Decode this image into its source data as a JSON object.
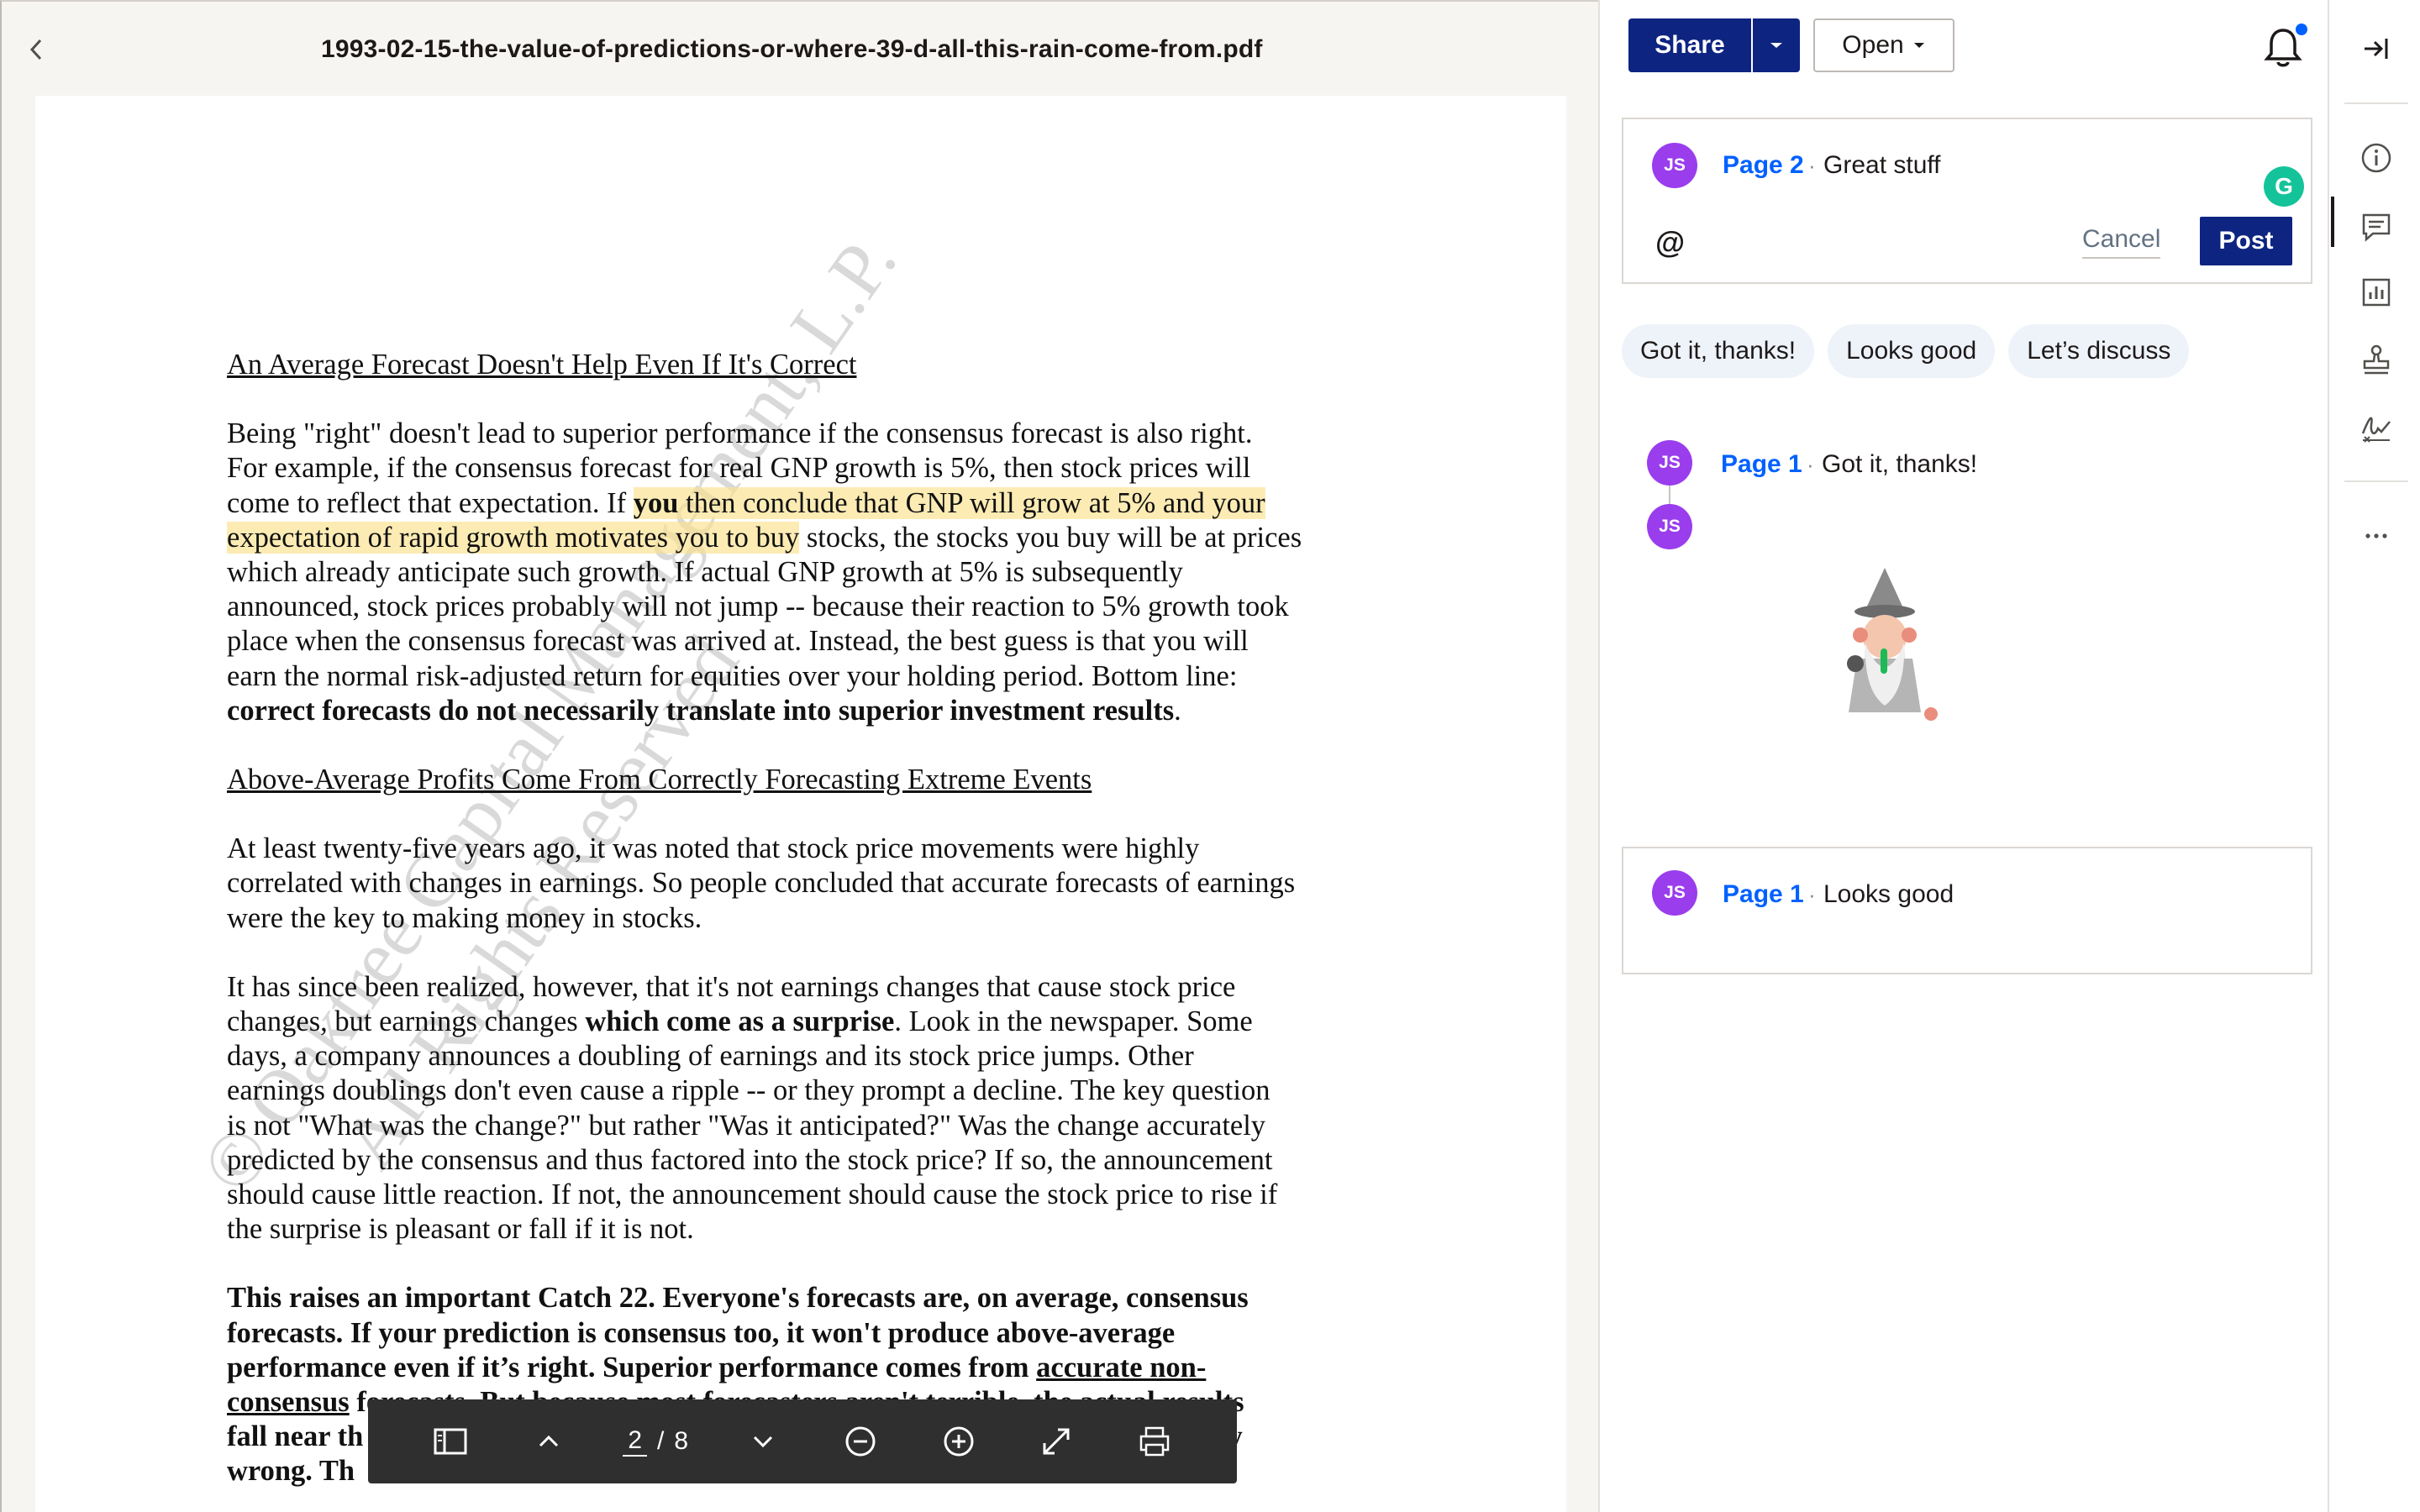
{
  "viewer": {
    "file_name": "1993-02-15-the-value-of-predictions-or-where-39-d-all-this-rain-come-from.pdf",
    "back_icon": "chevron-left-icon"
  },
  "document": {
    "heading1": "An Average Forecast Doesn't Help Even If It's Correct",
    "p1_lines": [
      "Being \"right\" doesn't lead to superior performance if the consensus forecast is also right.",
      "For example, if the consensus forecast for real GNP growth is 5%, then stock prices will",
      "come to reflect that expectation.  If "
    ],
    "p1_hl_bold": "you",
    "p1_hl_a": " then conclude that GNP will grow at 5% and your",
    "p1_hl_b": "expectation of rapid growth motivates you to buy",
    "p1_rest": " stocks, the stocks you buy will be at prices",
    "p1_lines2": [
      "which already anticipate such growth.  If actual GNP growth at 5% is subsequently",
      "announced, stock prices probably will not jump -- because their reaction to 5% growth took",
      "place when the consensus forecast was arrived at.  Instead, the best guess is that you will",
      "earn the normal risk-adjusted return for equities over your holding period.  Bottom line:"
    ],
    "p1_bold_end": "correct forecasts do not necessarily translate into superior investment results",
    "heading2": "Above-Average Profits Come From Correctly Forecasting Extreme Events",
    "p2_lines": [
      "At least twenty-five years ago, it was noted that stock price movements were highly",
      "correlated with changes in earnings.  So people concluded that accurate forecasts of earnings",
      "were the key to making money in stocks."
    ],
    "p3_line1": "It has since been realized, however, that it's not earnings changes that cause stock price",
    "p3_line2a": "changes, but earnings changes ",
    "p3_line2b": "which come as a surprise",
    "p3_line2c": ".  Look in the newspaper. Some",
    "p3_lines": [
      "days, a company announces a doubling of earnings and its stock price jumps.  Other",
      "earnings doublings don't even cause a ripple -- or they prompt a decline.  The key question",
      "is not \"What was the change?\" but rather \"Was it anticipated?\"  Was the change accurately",
      "predicted by the consensus and thus factored into the stock price?  If so, the announcement",
      "should cause little reaction.  If not, the announcement should cause the stock price to rise if",
      "the surprise is pleasant or fall if it is not."
    ],
    "p4_lines": [
      "This raises an important Catch 22.  Everyone's forecasts are, on average, consensus",
      "forecasts. If your prediction is consensus too, it won't produce above-average",
      "performance even if it’s right.  Superior performance comes from "
    ],
    "p4_ul": "accurate non-",
    "p4_ul2": "consensus",
    "p4_partial_a": " forecasts.  But because most forecasters aren't terrible, the actual results",
    "p4_partial_b": "fall near th",
    "p4_partial_b_end": "lly",
    "p4_partial_c": "wrong.  Th",
    "watermark_line1": "© Oaktree Capital Management, L.P.",
    "watermark_line2": "All Rights Reserved"
  },
  "toolbar": {
    "current_page": "2",
    "total_pages": "8",
    "separator": "/"
  },
  "panel": {
    "share_label": "Share",
    "open_label": "Open",
    "compose": {
      "initials": "JS",
      "page": "Page 2",
      "text": "Great stuff",
      "at_symbol": "@",
      "cancel_label": "Cancel",
      "post_label": "Post",
      "grammarly_letter": "G"
    },
    "chips": [
      "Got it, thanks!",
      "Looks good",
      "Let’s discuss"
    ],
    "comment1": {
      "initials": "JS",
      "page": "Page 1",
      "text": "Got it, thanks!",
      "reply_initials": "JS"
    },
    "comment2": {
      "initials": "JS",
      "page": "Page 1",
      "text": "Looks good"
    },
    "dot": "·"
  },
  "colors": {
    "brand": "#0d2481",
    "link": "#0061fe",
    "avatar": "#9a3ded",
    "highlight": "#fae28c",
    "chip_bg": "#eef3fa"
  },
  "rail_icons": [
    "collapse-panel-icon",
    "info-icon",
    "comment-icon",
    "stats-icon",
    "stamp-icon",
    "signature-icon",
    "more-icon"
  ]
}
